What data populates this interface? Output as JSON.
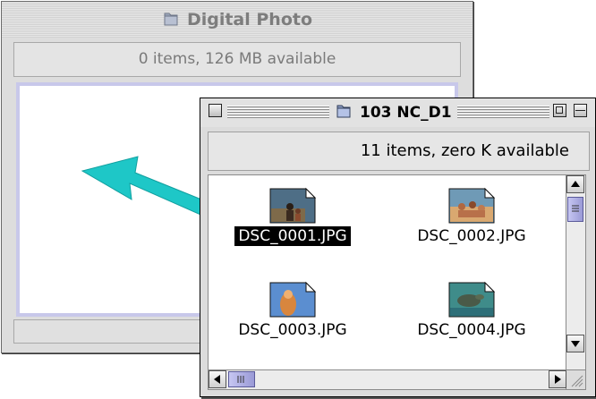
{
  "windows": {
    "back": {
      "title": "Digital Photo",
      "info": "0 items, 126 MB available"
    },
    "front": {
      "title": "103 NC_D1",
      "info": "11 items, zero K available",
      "files": [
        {
          "name": "DSC_0001.JPG",
          "selected": true,
          "thumb": "family-beach"
        },
        {
          "name": "DSC_0002.JPG",
          "selected": false,
          "thumb": "people-sand"
        },
        {
          "name": "DSC_0003.JPG",
          "selected": false,
          "thumb": "girl-sky"
        },
        {
          "name": "DSC_0004.JPG",
          "selected": false,
          "thumb": "turtle-sea"
        }
      ]
    }
  },
  "colors": {
    "arrow": "#1ec7c7",
    "selection": "#000000",
    "content_border": "#c8c8ea",
    "scroll_thumb": "#9a9ad6"
  },
  "icons": [
    "folder-icon",
    "close-box-icon",
    "zoom-box-icon",
    "collapse-box-icon",
    "scroll-up-arrow-icon",
    "scroll-down-arrow-icon",
    "scroll-left-arrow-icon",
    "scroll-right-arrow-icon",
    "grow-box-icon",
    "drag-arrow-icon"
  ]
}
